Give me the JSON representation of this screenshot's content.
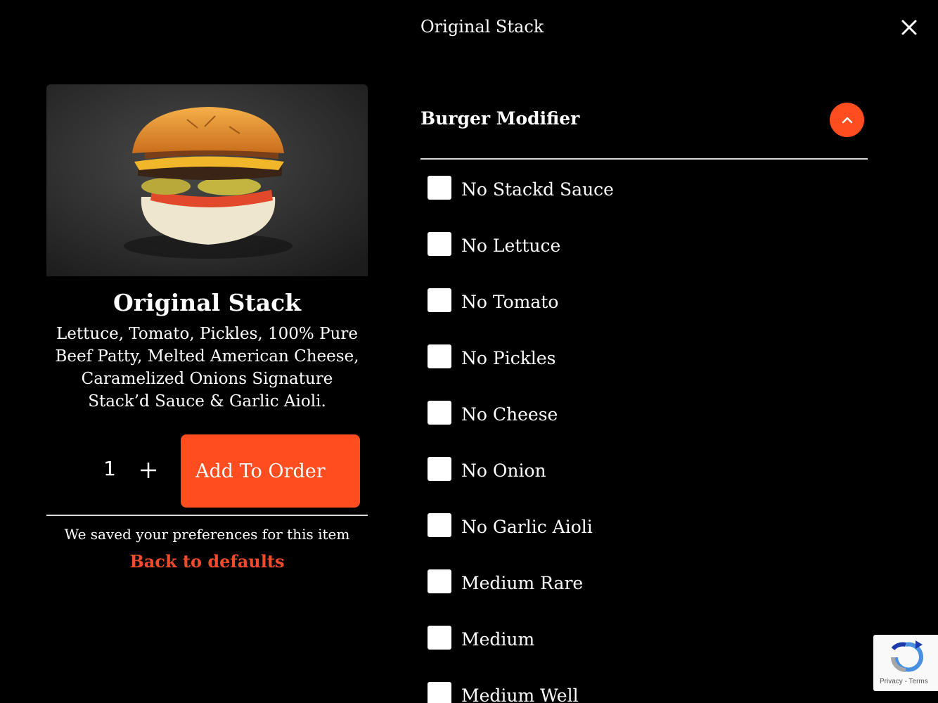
{
  "modal": {
    "title": "Original Stack"
  },
  "product": {
    "name": "Original Stack",
    "description": "Lettuce, Tomato, Pickles, 100% Pure Beef Patty, Melted American Cheese, Caramelized Onions Signature Stack’d Sauce & Garlic Aioli.",
    "quantity": "1",
    "add_button_label": "Add To Order"
  },
  "preferences": {
    "saved_note": "We saved your preferences for this item",
    "defaults_link": "Back to defaults"
  },
  "modifier_section": {
    "title": "Burger Modifier",
    "expanded": true,
    "options": [
      {
        "label": "No Stackd Sauce",
        "checked": false
      },
      {
        "label": "No Lettuce",
        "checked": false
      },
      {
        "label": "No Tomato",
        "checked": false
      },
      {
        "label": "No Pickles",
        "checked": false
      },
      {
        "label": "No Cheese",
        "checked": false
      },
      {
        "label": "No Onion",
        "checked": false
      },
      {
        "label": "No Garlic Aioli",
        "checked": false
      },
      {
        "label": "Medium Rare",
        "checked": false
      },
      {
        "label": "Medium",
        "checked": false
      },
      {
        "label": "Medium Well",
        "checked": false
      }
    ]
  },
  "recaptcha": {
    "privacy": "Privacy",
    "separator": " - ",
    "terms": "Terms"
  },
  "colors": {
    "accent": "#ff4d1f",
    "link": "#f14b2b",
    "background": "#000000"
  }
}
